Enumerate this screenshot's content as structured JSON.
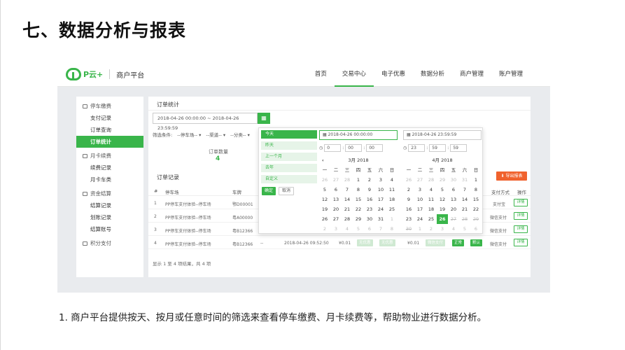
{
  "slide": {
    "title": "七、数据分析与报表",
    "caption": "1. 商户平台提供按天、按月或任意时间的筛选来查看停车缴费、月卡续费等，帮助物业进行数据分析。"
  },
  "colors": {
    "accent": "#39b54a",
    "export": "#f0622d"
  },
  "app": {
    "logo_text": "P云+",
    "logo_sub": "商户平台",
    "nav": [
      "首页",
      "交易中心",
      "电子优惠",
      "数据分析",
      "商户管理",
      "账户管理"
    ],
    "nav_active": "交易中心"
  },
  "sidebar": {
    "groups": [
      {
        "label": "停车缴费",
        "icon": "car-icon",
        "items": [
          "支付记录",
          "订单查询",
          "订单统计"
        ]
      },
      {
        "label": "月卡续费",
        "icon": "card-icon",
        "items": [
          "续费记录",
          "月卡车类"
        ]
      },
      {
        "label": "资金结算",
        "icon": "money-icon",
        "items": [
          "结算记录",
          "划账记录",
          "结算账号"
        ]
      },
      {
        "label": "积分支付",
        "icon": "points-icon",
        "items": []
      }
    ],
    "active_item": "订单统计"
  },
  "main": {
    "title": "订单统计",
    "range_value": "2018-04-26 00:00:00 ~ 2018-04-26 23:59:59",
    "filter_label": "筛选条件:",
    "filters": [
      "--停车场-- ▾",
      "--渠道-- ▾",
      "--分类-- ▾"
    ],
    "stats_label": "订单数量",
    "stats_value": "4",
    "records_title": "订单记录",
    "export_label": "导出报表",
    "columns": [
      "#",
      "停车场",
      "车牌",
      "支付方式",
      "操作"
    ],
    "rows": [
      {
        "no": "1",
        "lot": "PP停车支付体验--停车场",
        "plate": "鄂D00001",
        "pay": "支付宝",
        "action": "详情"
      },
      {
        "no": "2",
        "lot": "PP停车支付体验--停车场",
        "plate": "粤A00000",
        "pay": "微信支付",
        "action": "详情"
      },
      {
        "no": "3",
        "lot": "PP停车支付体验--停车场",
        "plate": "粤B12366",
        "pay": "微信支付",
        "action": "详情"
      },
      {
        "no": "4",
        "lot": "PP停车支付体验--停车场",
        "plate": "粤B12366",
        "dash": "--",
        "time": "2018-04-26 09:52:50",
        "amount1": "¥0.01",
        "tag1": "无优惠",
        "tag2": "无优惠",
        "amount2": "¥0.01",
        "tag3": "微信支付",
        "tag4": "正常",
        "tag5": "默认",
        "pay": "微信支付",
        "action": "详情"
      }
    ],
    "pager": "显示 1 至 4 项结果，共 4 项"
  },
  "picker": {
    "ranges": [
      "今天",
      "昨天",
      "上一个月",
      "去年",
      "自定义"
    ],
    "active_range": "今天",
    "apply": "确定",
    "cancel": "取消",
    "left": {
      "input": "2018-04-26 00:00:00",
      "time": [
        "0",
        "00",
        "00"
      ],
      "month": "3月 2018",
      "weekdays": [
        "一",
        "二",
        "三",
        "四",
        "五",
        "六",
        "日"
      ],
      "days": [
        "26",
        "27",
        "28",
        "1",
        "2",
        "3",
        "4",
        "5",
        "6",
        "7",
        "8",
        "9",
        "10",
        "11",
        "12",
        "13",
        "14",
        "15",
        "16",
        "17",
        "18",
        "19",
        "20",
        "21",
        "22",
        "23",
        "24",
        "25",
        "26",
        "27",
        "28",
        "29",
        "30",
        "31",
        "1",
        "2",
        "3",
        "4",
        "5",
        "6",
        "7",
        "8"
      ]
    },
    "right": {
      "input": "2018-04-26 23:59:59",
      "time": [
        "23",
        "59",
        "59"
      ],
      "month": "4月 2018",
      "weekdays": [
        "一",
        "二",
        "三",
        "四",
        "五",
        "六",
        "日"
      ],
      "days": [
        "26",
        "27",
        "28",
        "29",
        "30",
        "31",
        "1",
        "2",
        "3",
        "4",
        "5",
        "6",
        "7",
        "8",
        "9",
        "10",
        "11",
        "12",
        "13",
        "14",
        "15",
        "16",
        "17",
        "18",
        "19",
        "20",
        "21",
        "22",
        "23",
        "24",
        "25",
        "26",
        "27",
        "28",
        "29",
        "30",
        "1",
        "2",
        "3",
        "4",
        "5",
        "6"
      ]
    }
  }
}
